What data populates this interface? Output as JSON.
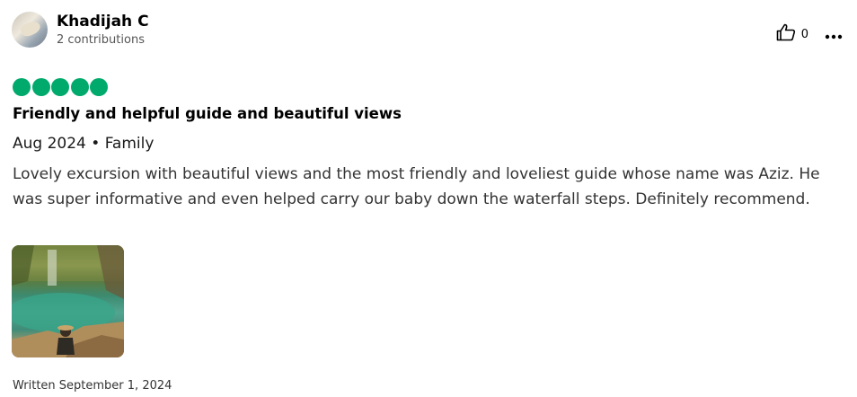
{
  "user": {
    "name": "Khadijah C",
    "contributions": "2 contributions"
  },
  "helpful": {
    "count": "0"
  },
  "review": {
    "rating": 5,
    "max_rating": 5,
    "title": "Friendly and helpful guide and beautiful views",
    "trip_info": "Aug 2024 • Family",
    "body": "Lovely excursion with beautiful views and the most friendly and loveliest guide whose name was Aziz. He was super informative and even helped carry our baby down the waterfall steps. Definitely recommend.",
    "written": "Written September 1, 2024"
  },
  "colors": {
    "rating_bubble": "#00aa6c",
    "text": "#1a1a1a"
  },
  "icons": {
    "helpful": "thumbs-up-icon",
    "more": "more-options-icon"
  }
}
